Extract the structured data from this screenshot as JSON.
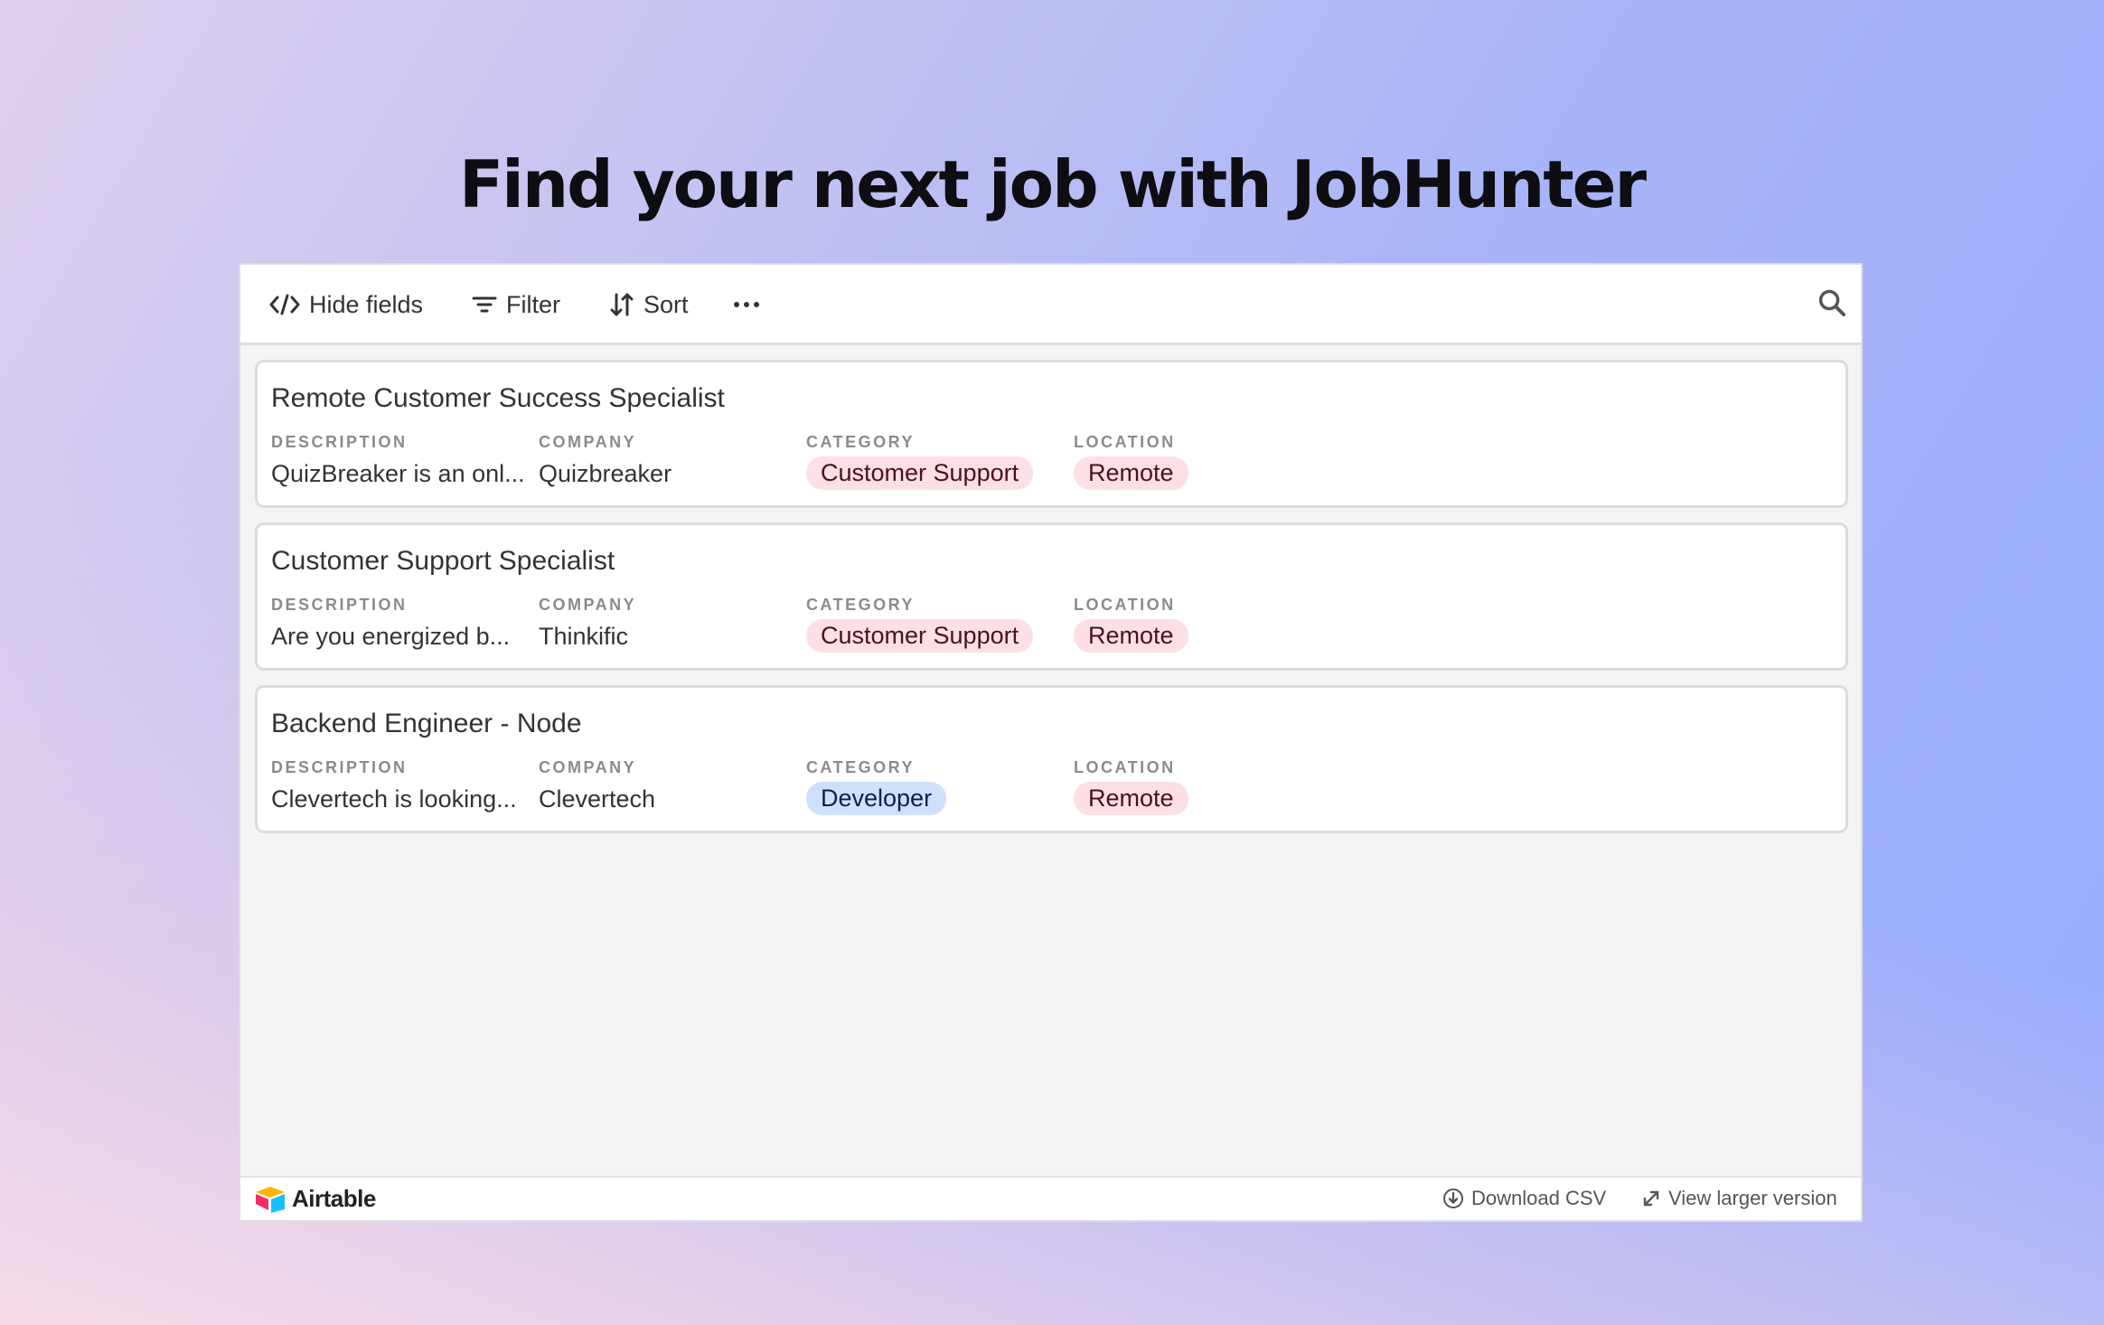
{
  "page": {
    "headline": "Find your next job with JobHunter"
  },
  "toolbar": {
    "hide_fields": "Hide fields",
    "filter": "Filter",
    "sort": "Sort",
    "more_icon": "ellipsis-icon",
    "search_icon": "search-icon"
  },
  "field_labels": {
    "description": "DESCRIPTION",
    "company": "COMPANY",
    "category": "CATEGORY",
    "location": "LOCATION"
  },
  "records": [
    {
      "title": "Remote Customer Success Specialist",
      "description": "QuizBreaker is an onl...",
      "company": "Quizbreaker",
      "category": "Customer Support",
      "location": "Remote"
    },
    {
      "title": "Customer Support Specialist",
      "description": "Are you energized b...",
      "company": "Thinkific",
      "category": "Customer Support",
      "location": "Remote"
    },
    {
      "title": "Backend Engineer - Node",
      "description": "Clevertech is looking...",
      "company": "Clevertech",
      "category": "Developer",
      "location": "Remote"
    }
  ],
  "footer": {
    "brand": "Airtable",
    "download_csv": "Download CSV",
    "view_larger": "View larger version"
  },
  "colors": {
    "pill_customer_support": "#fde0e6",
    "pill_developer": "#cfe0fd",
    "pill_remote": "#fde0e6"
  }
}
